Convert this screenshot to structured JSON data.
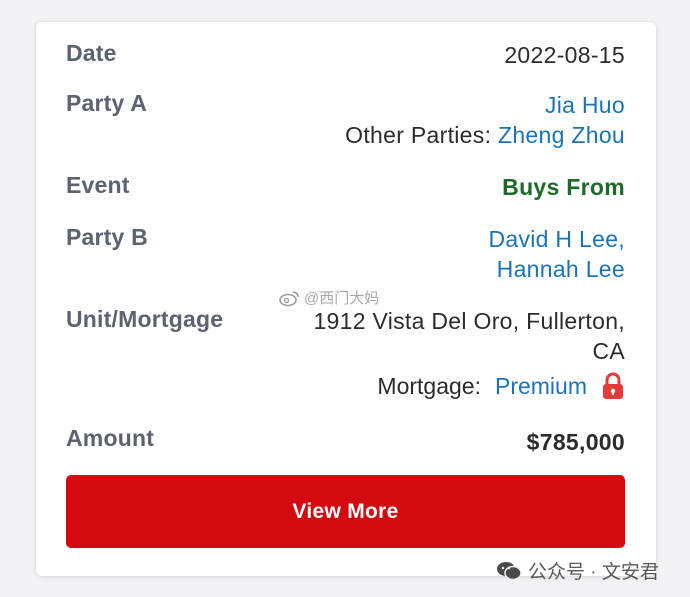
{
  "record": {
    "date_label": "Date",
    "date_value": "2022-08-15",
    "party_a_label": "Party A",
    "party_a_name": "Jia Huo",
    "other_parties_prefix": "Other Parties:",
    "other_parties_name": "Zheng Zhou",
    "event_label": "Event",
    "event_value": "Buys From",
    "party_b_label": "Party B",
    "party_b_name_1": "David H Lee,",
    "party_b_name_2": "Hannah Lee",
    "unit_label": "Unit/Mortgage",
    "address_line_1": "1912 Vista Del Oro, Fullerton,",
    "address_line_2": "CA",
    "mortgage_prefix": "Mortgage:",
    "mortgage_value": "Premium",
    "amount_label": "Amount",
    "amount_value": "$785,000"
  },
  "actions": {
    "view_more_label": "View More"
  },
  "watermarks": {
    "center_text": "@西门大妈",
    "bottom_text": "公众号 · 文安君"
  },
  "colors": {
    "link": "#1a73b8",
    "event": "#1c6b2a",
    "button": "#d40a10",
    "label": "#5b6270"
  },
  "icons": {
    "lock": "lock-icon",
    "weibo": "weibo-icon",
    "wechat": "wechat-icon"
  }
}
